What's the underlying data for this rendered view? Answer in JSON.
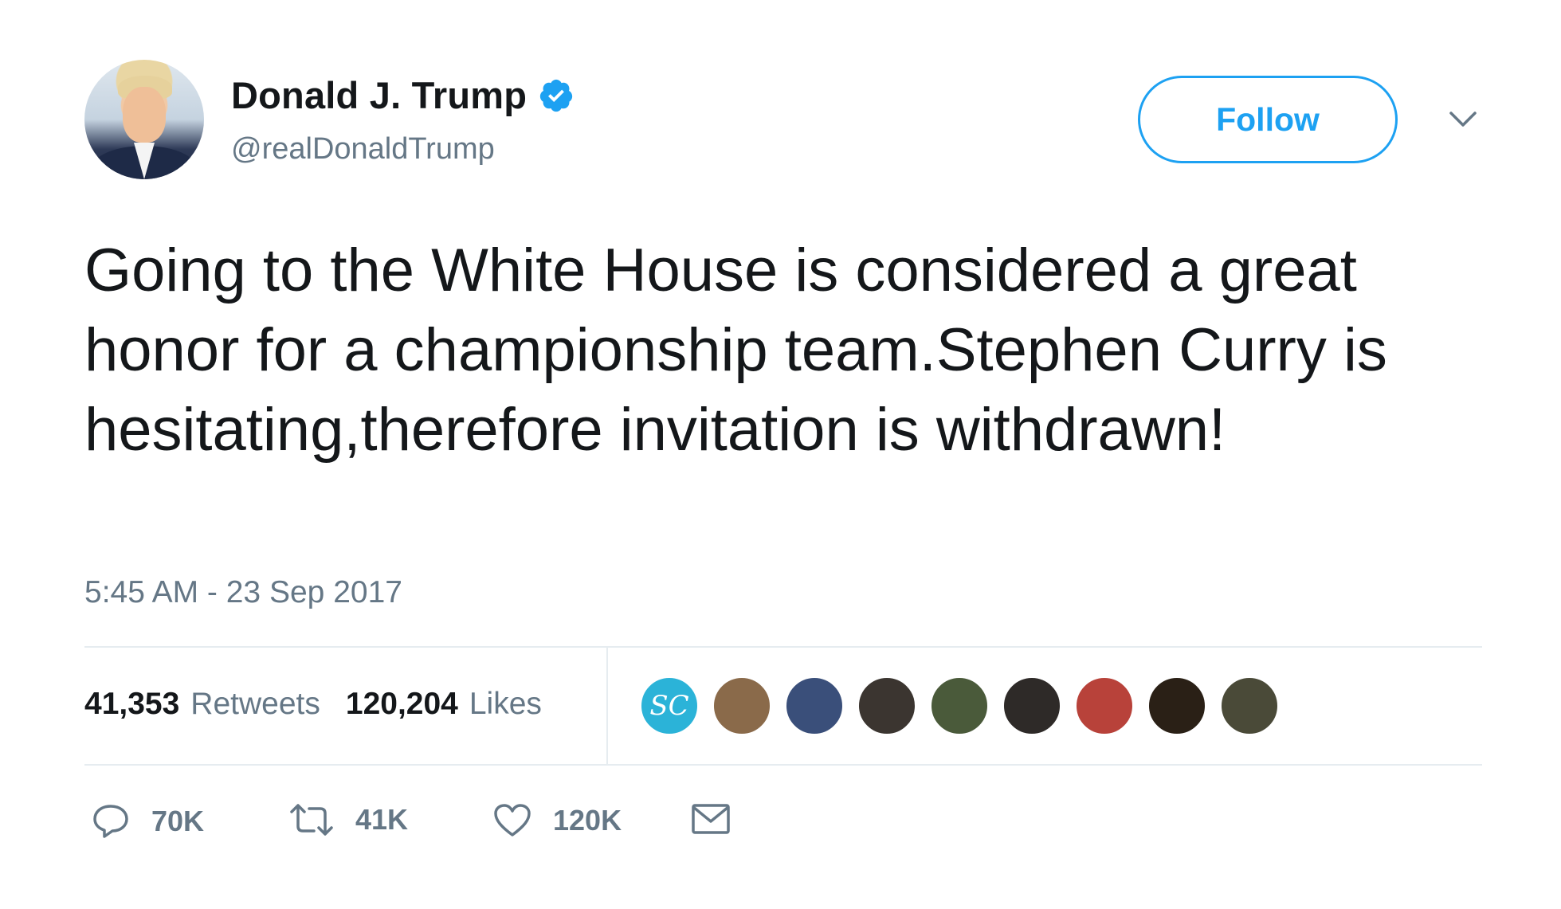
{
  "author": {
    "display_name": "Donald J. Trump",
    "handle": "@realDonaldTrump",
    "verified": true,
    "avatar_icon": "profile-photo"
  },
  "follow_button": {
    "label": "Follow"
  },
  "menu": {
    "icon": "chevron-down-icon"
  },
  "tweet": {
    "text": "Going to the White House is considered a great honor for a championship team.Stephen Curry is hesitating,therefore invitation is withdrawn!",
    "timestamp": "5:45 AM - 23 Sep 2017"
  },
  "stats": {
    "retweets_count": "41,353",
    "retweets_label": "Retweets",
    "likes_count": "120,204",
    "likes_label": "Likes"
  },
  "likers": [
    {
      "initials": "SC",
      "color": "#2bb3d8"
    },
    {
      "color": "#8a6a4a"
    },
    {
      "color": "#3a4f7a"
    },
    {
      "color": "#3b3530"
    },
    {
      "color": "#4a5a3a"
    },
    {
      "color": "#2e2a28"
    },
    {
      "color": "#b8423a"
    },
    {
      "color": "#2a2016"
    },
    {
      "color": "#4a4a38"
    }
  ],
  "actions": {
    "reply": {
      "icon": "reply-icon",
      "count": "70K"
    },
    "retweet": {
      "icon": "retweet-icon",
      "count": "41K"
    },
    "like": {
      "icon": "heart-icon",
      "count": "120K"
    },
    "message": {
      "icon": "envelope-icon"
    }
  },
  "colors": {
    "accent": "#1da1f2",
    "text": "#14171a",
    "secondary": "#657786",
    "divider": "#e6ecf0"
  }
}
